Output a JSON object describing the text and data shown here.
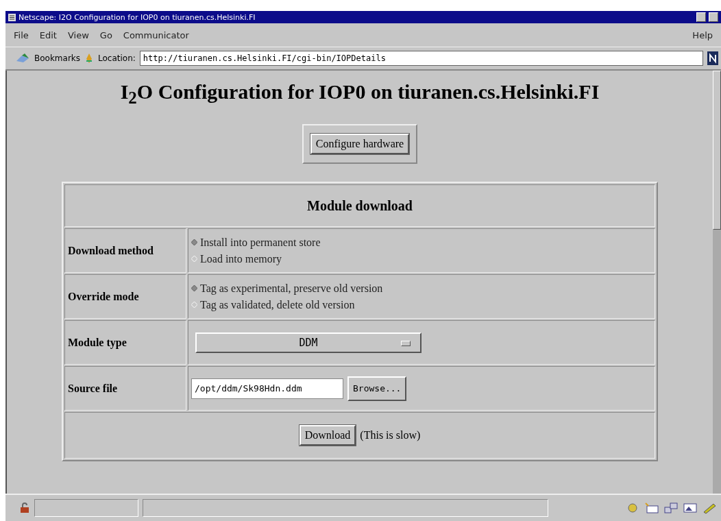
{
  "window": {
    "title": "Netscape: I2O Configuration for IOP0 on tiuranen.cs.Helsinki.FI"
  },
  "menu": [
    {
      "label": "File"
    },
    {
      "label": "Edit"
    },
    {
      "label": "View"
    },
    {
      "label": "Go"
    },
    {
      "label": "Communicator"
    }
  ],
  "help": "Help",
  "toolbar": {
    "bookmarks": "Bookmarks",
    "location_label": "Location:",
    "url": "http://tiuranen.cs.Helsinki.FI/cgi-bin/IOPDetails"
  },
  "page": {
    "heading": "I$_{2}$O Configuration for IOP0 on tiuranen.cs.Helsinki.FI",
    "configure_button": "Configure hardware",
    "table": {
      "title": "Module download",
      "rows": [
        {
          "kind": "radio",
          "label": "Download method",
          "options": [
            {
              "label": "Install into permanent store",
              "selected": true
            },
            {
              "label": "Load into memory",
              "selected": false
            }
          ]
        },
        {
          "kind": "radio",
          "label": "Override mode",
          "options": [
            {
              "label": "Tag as experimental, preserve old version",
              "selected": true
            },
            {
              "label": "Tag as validated, delete old version",
              "selected": false
            }
          ]
        },
        {
          "kind": "select",
          "label": "Module type",
          "value": "DDM"
        },
        {
          "kind": "file",
          "label": "Source file",
          "value": "/opt/ddm/Sk98Hdn.ddm",
          "button": "Browse..."
        }
      ],
      "download_button": "Download",
      "note": "(This is slow)"
    }
  }
}
